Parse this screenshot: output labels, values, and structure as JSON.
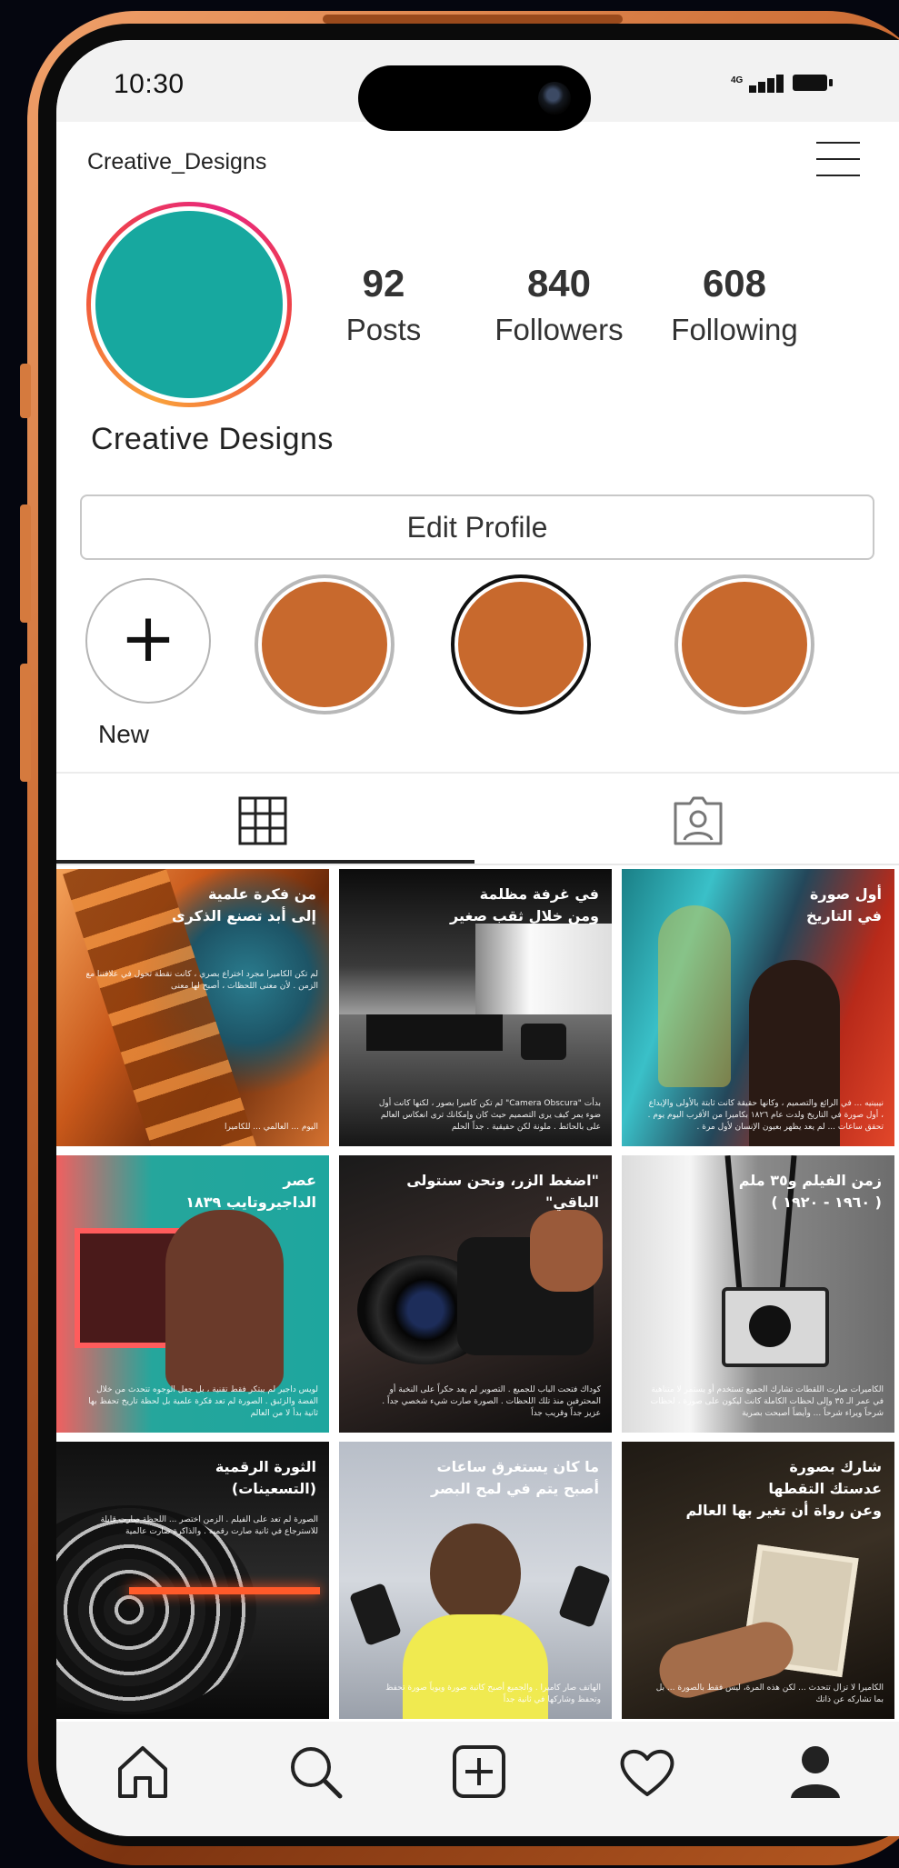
{
  "status_bar": {
    "time": "10:30",
    "network": "4G",
    "icons": [
      "signal-icon",
      "battery-icon"
    ]
  },
  "profile": {
    "username": "Creative_Designs",
    "display_name": "Creative Designs",
    "avatar_color": "#17a89f",
    "stats": [
      {
        "value": "92",
        "label": "Posts"
      },
      {
        "value": "840",
        "label": "Followers"
      },
      {
        "value": "608",
        "label": "Following"
      }
    ],
    "edit_button": "Edit Profile"
  },
  "highlights": {
    "new_label": "New",
    "highlight_color": "#c8692d"
  },
  "tabs": [
    {
      "icon": "grid-icon",
      "active": true
    },
    {
      "icon": "tagged-person-icon",
      "active": false
    }
  ],
  "posts": [
    {
      "title_1": "من فكرة علمية",
      "title_2": "إلى أبد تصنع الذكرى",
      "body": "لم تكن الكاميرا مجرد اختراع بصري ، كانت نقطة تحول في علاقتنا مع الزمن . لأن معنى اللحظات ، أصبح لها معنى",
      "footer": "اليوم ... العالمي ... للكاميرا"
    },
    {
      "title_1": "في غرفة مظلمة",
      "title_2": "ومن خلال ثقب صغير",
      "body": "بدأت \"Camera Obscura\" لم تكن كاميرا بصور ، لكنها كانت أول ضوء يمر كيف يرى التصميم حيث كان وإمكانك ترى انعكاس العالم على بالحائط . ملونة لكن حقيقية . جداً الحلم",
      "footer": ""
    },
    {
      "title_1": "أول صورة",
      "title_2": "في التاريخ",
      "body": "نيبينيه ... في الرائع والتصميم ، وكانها حقيقة كانت ثابتة بالأولى والإبداع ، أول صورة في التاريخ ولدت عام ١٨٢٦ بكاميرا من الأقرب اليوم يوم . تحقق ساعات ... لم يعد يظهر بعيون الإنسان لأول مرة .",
      "footer": ""
    },
    {
      "title_1": "عصر",
      "title_2": "الداجيروتايب ١٨٣٩",
      "body": "لويس داجير لم يبتكر فقط تقنية ، بل جعل الوجوه تتحدث من خلال الفضة والزئبق . الصورة لم تعد فكرة علمية بل لحظة تاريخ تحفظ بها ثانية بدأ لا من العالم",
      "footer": ""
    },
    {
      "title_1": "\"اضغط الزر، ونحن سنتولى الباقي\"",
      "title_2": "",
      "body": "كوداك فتحت الباب للجميع . التصوير لم يعد حكراً على النخبة أو المحترفين منذ تلك اللحظات . الصورة صارت شيء شخصي جداً . عزيز جداً وقريب جداً",
      "footer": ""
    },
    {
      "title_1": "زمن الفيلم و٣٥ ملم",
      "title_2": "( ١٩٦٠ - ١٩٢٠ )",
      "body": "الكاميرات صارت اللقطات تشارك الجميع تستخدم أو يستمر لا متناهية في عمر الـ ٣٥ وإلى لحظات الكاملة كانت ليكون على صورة ، لحظات شرحاً ويراء شرحاً ... وأيضاً أصبحت بصرية",
      "footer": ""
    },
    {
      "title_1": "الثورة الرقمية",
      "title_2": "(التسعينات)",
      "body": "الصورة لم تعد على الفيلم . الزمن اختصر ... اللحظة صارت قابلة للاسترجاع في ثانية صارت رقمية . والذاكرة صارت عالمية",
      "footer": ""
    },
    {
      "title_1": "ما كان يستغرق ساعات",
      "title_2": "أصبح يتم في لمح البصر",
      "body": "الهاتف صار كاميرا . والجميع أصبح كاتبة صورة ويوياً صورة تحفظ وتحفظ وشاركها في ثانية جداً",
      "footer": ""
    },
    {
      "title_1": "شارك بصورة",
      "title_2": "عدستك التقطها",
      "body": "الكاميرا لا تزال تتحدث ... لكن هذه المرة، ليس فقط بالصورة ... بل بما تشاركه عن ذاتك",
      "footer": "وعن رواة أن تغير بها العالم"
    }
  ],
  "bottom_nav": [
    {
      "icon": "home-icon"
    },
    {
      "icon": "search-icon"
    },
    {
      "icon": "add-post-icon"
    },
    {
      "icon": "heart-icon"
    },
    {
      "icon": "profile-icon"
    }
  ]
}
